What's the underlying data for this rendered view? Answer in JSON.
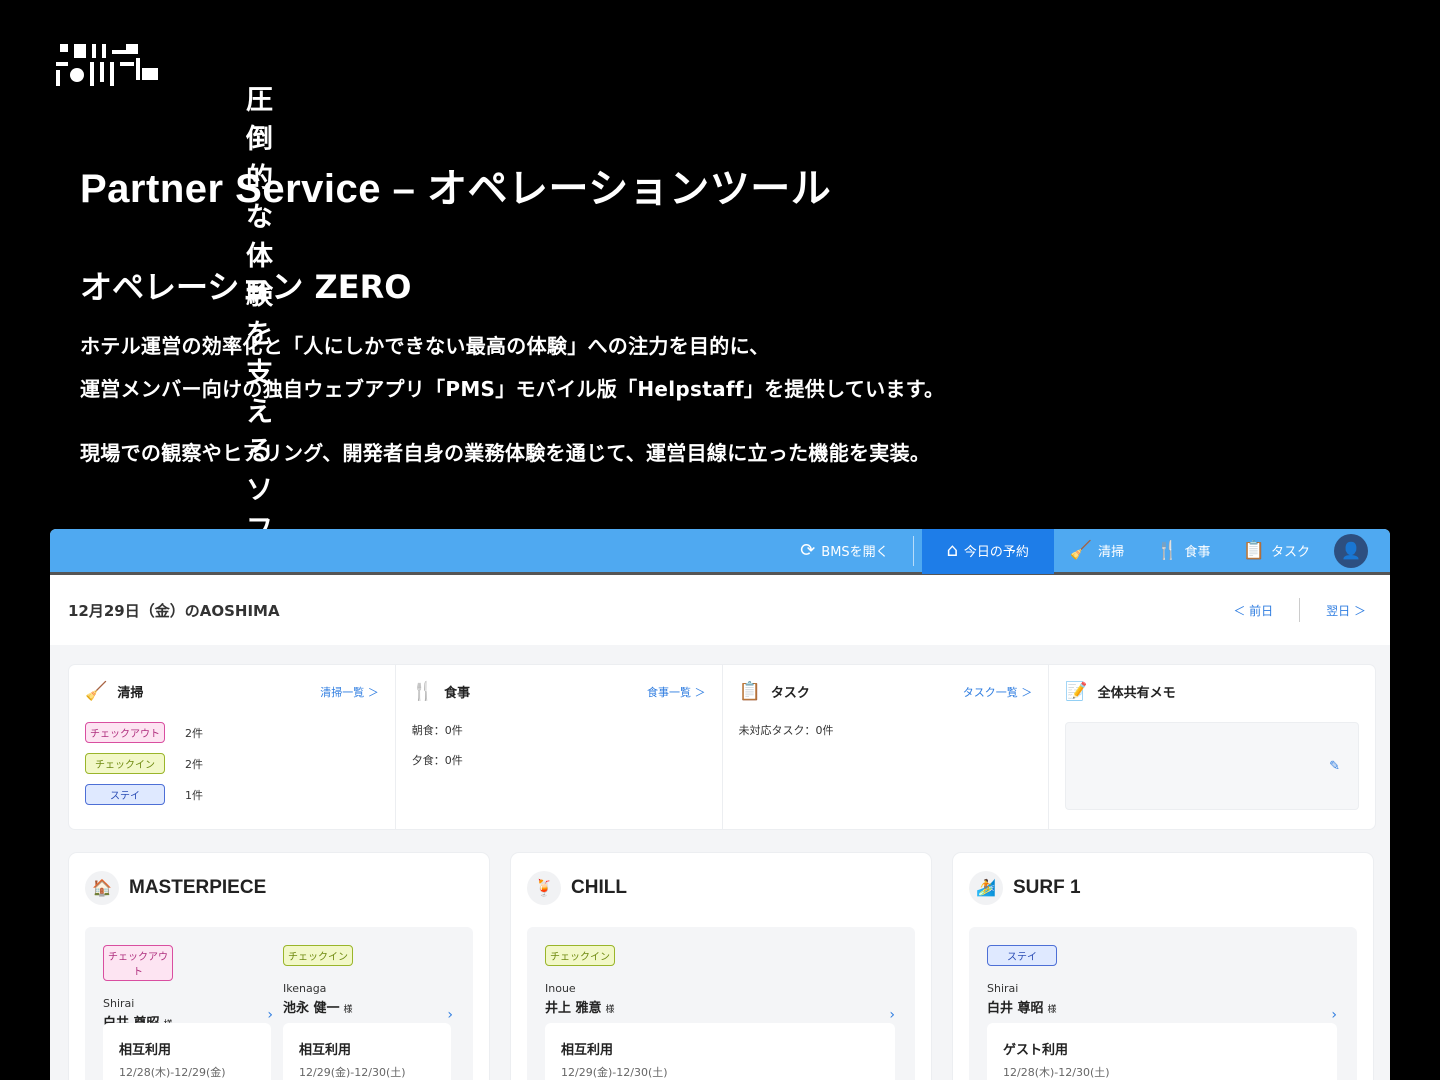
{
  "header": {
    "deck_title": "圧倒的な体験を支えるソフトウェア群"
  },
  "title": "Partner Service – オペレーションツール",
  "subtitle": "オペレーション ZERO",
  "description": {
    "line1": "ホテル運営の効率化と「人にしかできない最高の体験」への注力を目的に、",
    "line2": "運営メンバー向けの独自ウェブアプリ「PMS」モバイル版「Helpstaff」を提供しています。",
    "line3": "現場での観察やヒアリング、開発者自身の業務体験を通じて、運営目線に立った機能を実装。"
  },
  "app": {
    "nav": {
      "bms": "BMSを開く",
      "today": "今日の予約",
      "cleaning": "清掃",
      "meal": "食事",
      "task": "タスク"
    },
    "date_label": "12月29日（金）のAOSHIMA",
    "prev_day": "＜ 前日",
    "next_day": "翌日 ＞",
    "summary": {
      "cleaning": {
        "title": "清掃",
        "link": "清掃一覧 ＞",
        "rows": [
          {
            "badge": "チェックアウト",
            "count": "2件"
          },
          {
            "badge": "チェックイン",
            "count": "2件"
          },
          {
            "badge": "ステイ",
            "count": "1件"
          }
        ]
      },
      "meal": {
        "title": "食事",
        "link": "食事一覧 ＞",
        "breakfast": "朝食：0件",
        "dinner": "夕食：0件"
      },
      "task": {
        "title": "タスク",
        "link": "タスク一覧 ＞",
        "pending": "未対応タスク：0件"
      },
      "memo": {
        "title": "全体共有メモ"
      }
    },
    "rooms": [
      {
        "name": "MASTERPIECE",
        "icon": "🏠",
        "guests": [
          {
            "badge": "チェックアウト",
            "roman": "Shirai",
            "name": "白井 尊昭",
            "honorific": "様",
            "plan": "相互利用",
            "dates": "12/28(木)-12/29(金)"
          },
          {
            "badge": "チェックイン",
            "roman": "Ikenaga",
            "name": "池永 健一",
            "honorific": "様",
            "plan": "相互利用",
            "dates": "12/29(金)-12/30(土)"
          }
        ]
      },
      {
        "name": "CHILL",
        "icon": "🍹",
        "guests": [
          {
            "badge": "チェックイン",
            "roman": "Inoue",
            "name": "井上 雅意",
            "honorific": "様",
            "plan": "相互利用",
            "dates": "12/29(金)-12/30(土)"
          }
        ]
      },
      {
        "name": "SURF 1",
        "icon": "🏄",
        "guests": [
          {
            "badge": "ステイ",
            "roman": "Shirai",
            "name": "白井 尊昭",
            "honorific": "様",
            "plan": "ゲスト利用",
            "dates": "12/28(木)-12/30(土)"
          }
        ]
      }
    ]
  }
}
